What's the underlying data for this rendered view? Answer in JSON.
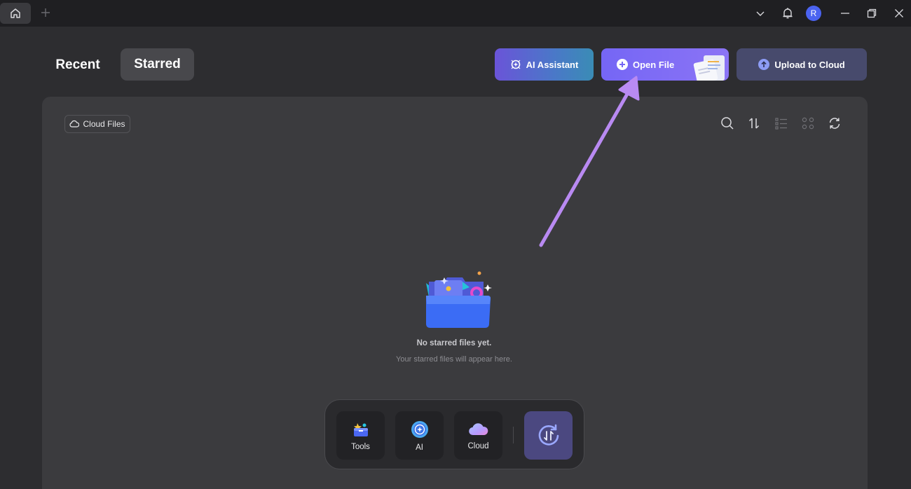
{
  "titlebar": {
    "icons": [
      "home-icon",
      "plus-icon",
      "chevron-down-icon",
      "bell-icon",
      "minimize-icon",
      "restore-icon",
      "close-icon"
    ],
    "avatar_initial": "R",
    "avatar_color": "#4b63f0"
  },
  "header": {
    "tabs": [
      {
        "label": "Recent",
        "active": false
      },
      {
        "label": "Starred",
        "active": true
      }
    ],
    "buttons": {
      "ai_assistant": "AI Assistant",
      "open_file": "Open File",
      "upload_to_cloud": "Upload to Cloud"
    }
  },
  "panel": {
    "cloud_files_label": "Cloud Files",
    "toolbar_icons": [
      "search-icon",
      "sort-icon",
      "list-view-icon",
      "grid-view-icon",
      "refresh-icon"
    ],
    "empty_title": "No starred files yet.",
    "empty_subtitle": "Your starred files will appear here."
  },
  "dock": {
    "items": [
      {
        "label": "Tools",
        "icon": "tools-icon"
      },
      {
        "label": "AI",
        "icon": "ai-icon"
      },
      {
        "label": "Cloud",
        "icon": "cloud-icon"
      }
    ],
    "switch_icon": "switch-mode-icon"
  },
  "colors": {
    "accent": "#7566f5",
    "annotation_arrow": "#b98af2",
    "panel_bg": "#3b3b3e",
    "window_bg": "#2d2d30"
  }
}
